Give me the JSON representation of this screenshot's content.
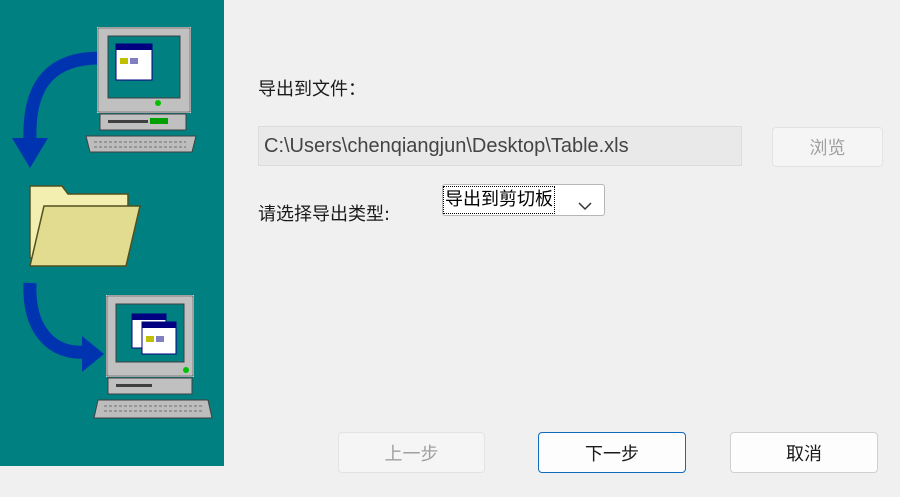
{
  "export": {
    "file_label": "导出到文件：",
    "file_path": "C:\\Users\\chenqiangjun\\Desktop\\Table.xls",
    "browse_label": "浏览",
    "type_label": "请选择导出类型:",
    "type_selected": "导出到剪切板"
  },
  "footer": {
    "back_label": "上一步",
    "next_label": "下一步",
    "cancel_label": "取消"
  },
  "colors": {
    "panel": "#008080",
    "arrow": "#0033b0",
    "primary_border": "#0f6cbd"
  },
  "icons": {
    "panel_images": [
      "computer-icon",
      "curved-arrow-icon",
      "folder-icon",
      "computer-icon"
    ],
    "select_arrow": "chevron-down-icon"
  }
}
